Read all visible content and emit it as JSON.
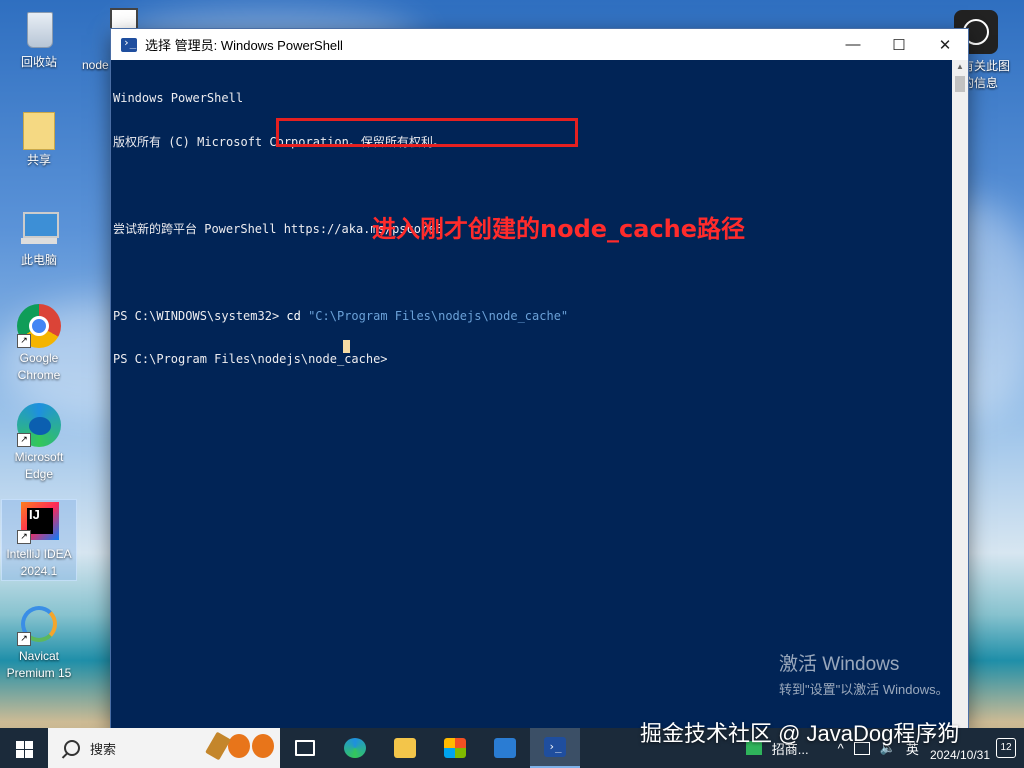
{
  "desktop": {
    "icons": [
      {
        "label": "回收站"
      },
      {
        "label": "共享"
      },
      {
        "label": "此电脑"
      },
      {
        "label": "Google Chrome"
      },
      {
        "label": "Microsoft Edge"
      },
      {
        "label": "IntelliJ IDEA 2024.1"
      },
      {
        "label": "Navicat Premium 15"
      }
    ],
    "partial_icon_label": "node",
    "right_icon_label": "有关此图\n的信息"
  },
  "window": {
    "title": "选择 管理员: Windows PowerShell",
    "controls": {
      "minimize": "—",
      "maximize": "☐",
      "close": "✕"
    },
    "console_lines": [
      "Windows PowerShell",
      "版权所有 (C) Microsoft Corporation。保留所有权利。",
      "",
      "尝试新的跨平台 PowerShell https://aka.ms/pscore6",
      ""
    ],
    "prompt1": "PS C:\\WINDOWS\\system32> ",
    "command": "cd",
    "command_arg": " \"C:\\Program Files\\nodejs\\node_cache\"",
    "prompt2": "PS C:\\Program Files\\nodejs\\node_cache>"
  },
  "annotation": "进入刚才创建的node_cache路径",
  "watermark": {
    "activate_title": "激活 Windows",
    "activate_sub": "转到\"设置\"以激活 Windows。",
    "juejin": "掘金技术社区 @ JavaDog程序狗"
  },
  "taskbar": {
    "search_placeholder": "搜索",
    "running_app": "招商...",
    "ime": "英",
    "date": "2024/10/31",
    "notification_count": "12"
  },
  "colors": {
    "console_bg": "#012456",
    "highlight": "#e52020",
    "annotation": "#ff2b2b"
  }
}
